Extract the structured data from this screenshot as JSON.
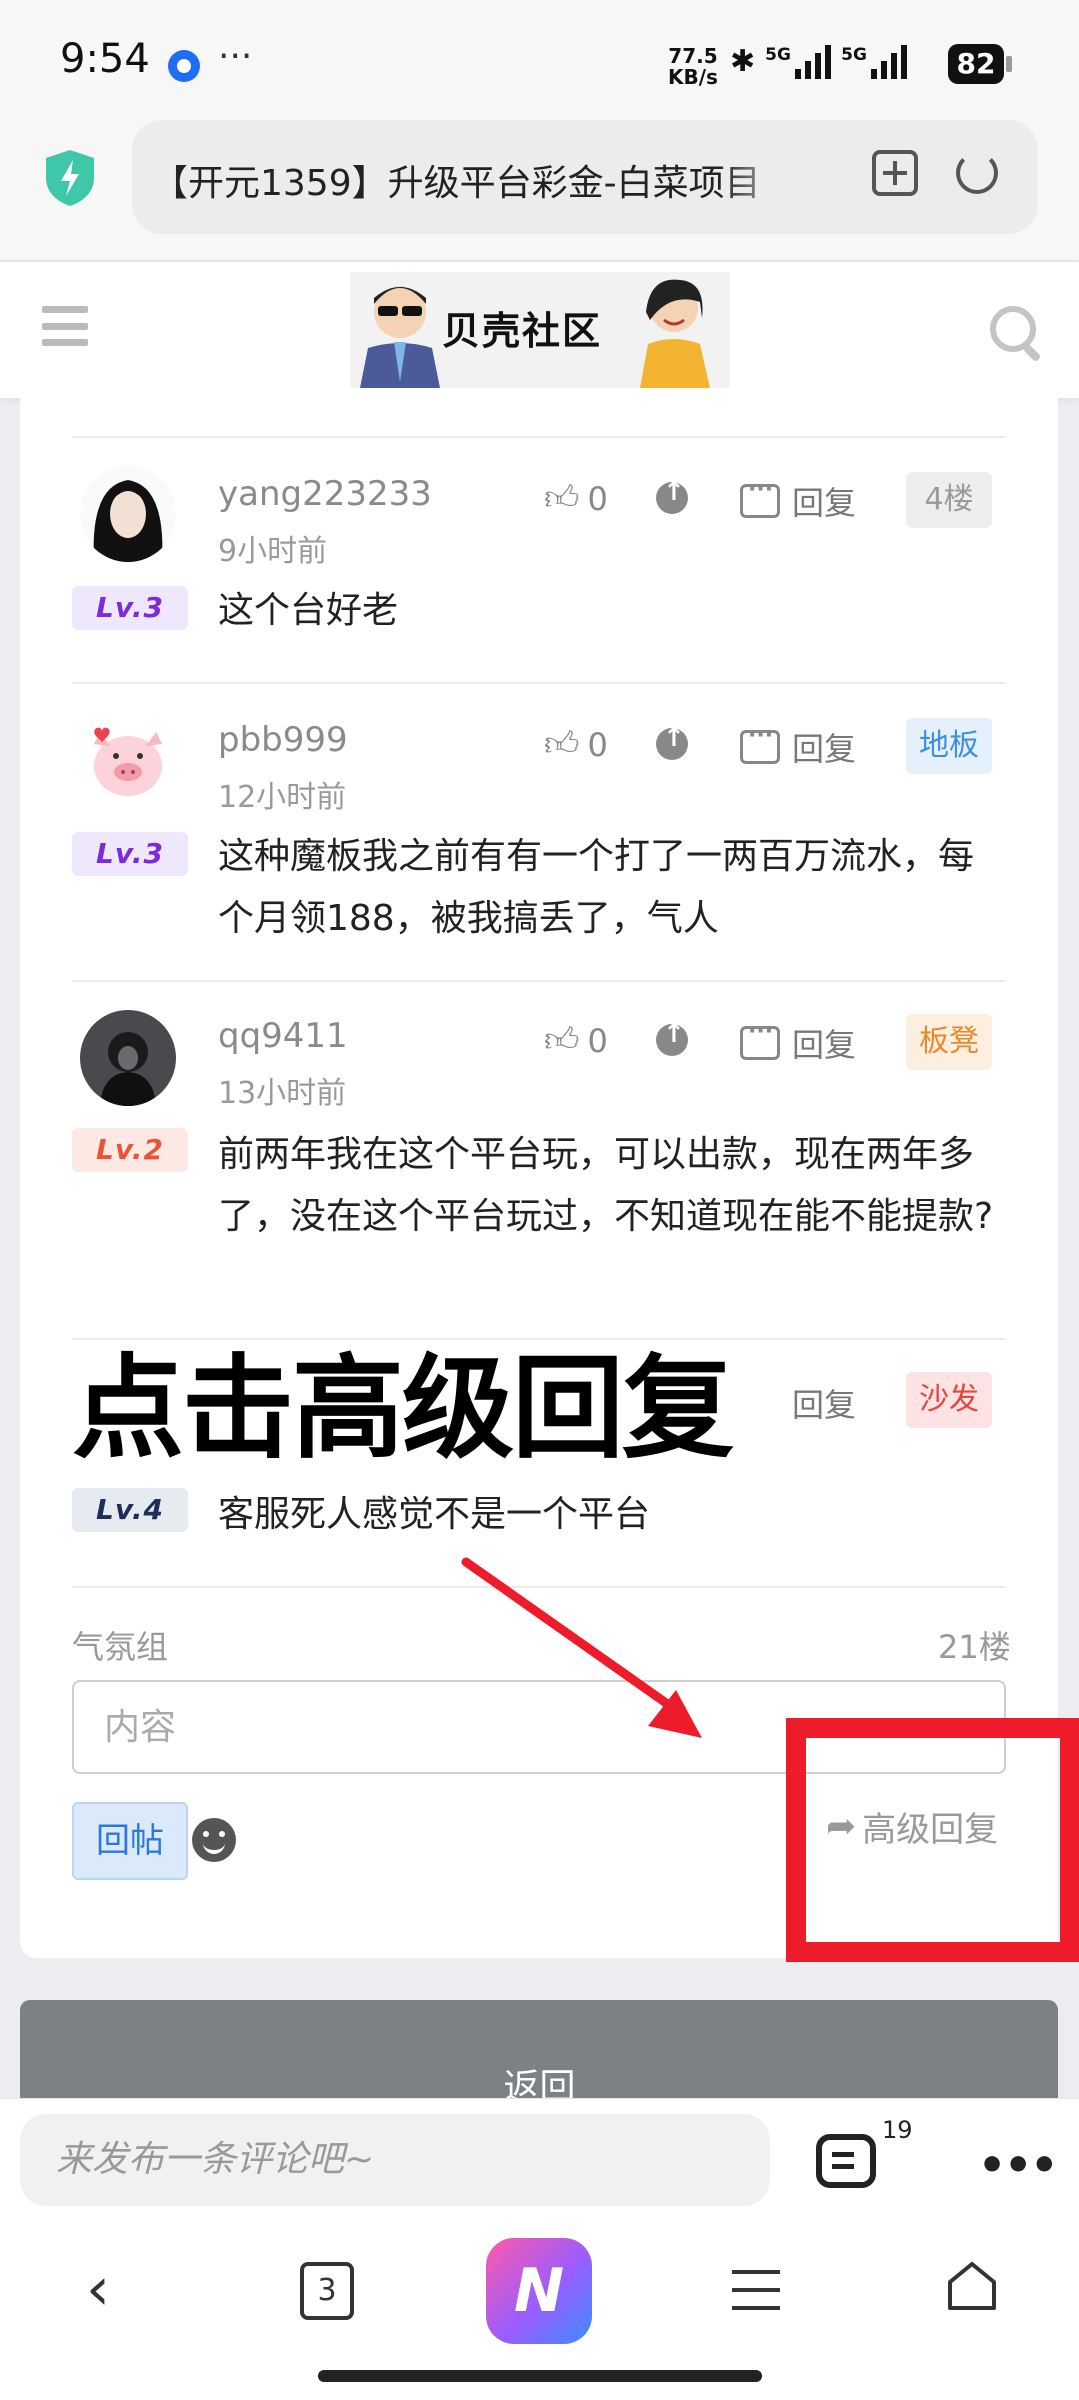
{
  "status_bar": {
    "time": "9:54",
    "speed_value": "77.5",
    "speed_unit": "KB/s",
    "signal_1": "5G",
    "signal_2": "5G",
    "battery": "82"
  },
  "address_bar": {
    "url_title": "【开元1359】升级平台彩金-白菜项目"
  },
  "site": {
    "logo_text": "贝壳社区"
  },
  "comments": [
    {
      "username": "yang223233",
      "time": "9小时前",
      "level": "Lv.3",
      "likes": "0",
      "reply_label": "回复",
      "floor": "4楼",
      "text": "这个台好老"
    },
    {
      "username": "pbb999",
      "time": "12小时前",
      "level": "Lv.3",
      "likes": "0",
      "reply_label": "回复",
      "floor": "地板",
      "text": "这种魔板我之前有有一个打了一两百万流水，每个月领188，被我搞丢了，气人"
    },
    {
      "username": "qq9411",
      "time": "13小时前",
      "level": "Lv.2",
      "likes": "0",
      "reply_label": "回复",
      "floor": "板凳",
      "text": "前两年我在这个平台玩，可以出款，现在两年多了，没在这个平台玩过，不知道现在能不能提款?"
    },
    {
      "username": "",
      "time": "",
      "level": "Lv.4",
      "likes": "",
      "reply_label": "回复",
      "floor": "沙发",
      "text": "客服死人感觉不是一个平台"
    }
  ],
  "overlay": {
    "caption": "点击高级回复"
  },
  "reply_form": {
    "group_label": "气氛组",
    "floor_count": "21楼",
    "content_placeholder": "内容",
    "post_button": "回帖",
    "advanced_reply": "高级回复"
  },
  "back_button": "返回",
  "comment_bar": {
    "placeholder": "来发布一条评论吧~",
    "count": "19"
  },
  "nav": {
    "tab_count": "3",
    "ai_label": "N"
  },
  "colors": {
    "lv3_bg": "#efe7fb",
    "lv3_fg": "#7b2bd9",
    "lv2_bg": "#fde9e3",
    "lv2_fg": "#e8543a",
    "lv4_bg": "#e6eaf1",
    "lv4_fg": "#1e2f57",
    "floor4_bg": "#eeeeee",
    "floor4_fg": "#9a9a9a",
    "floor_diban_bg": "#e4f1fc",
    "floor_diban_fg": "#3f8fe0",
    "floor_bandeng_bg": "#fdefe0",
    "floor_bandeng_fg": "#e58a2a",
    "floor_shafa_bg": "#fde3e3",
    "floor_shafa_fg": "#e4473d",
    "highlight_red": "#ee1c2a"
  }
}
